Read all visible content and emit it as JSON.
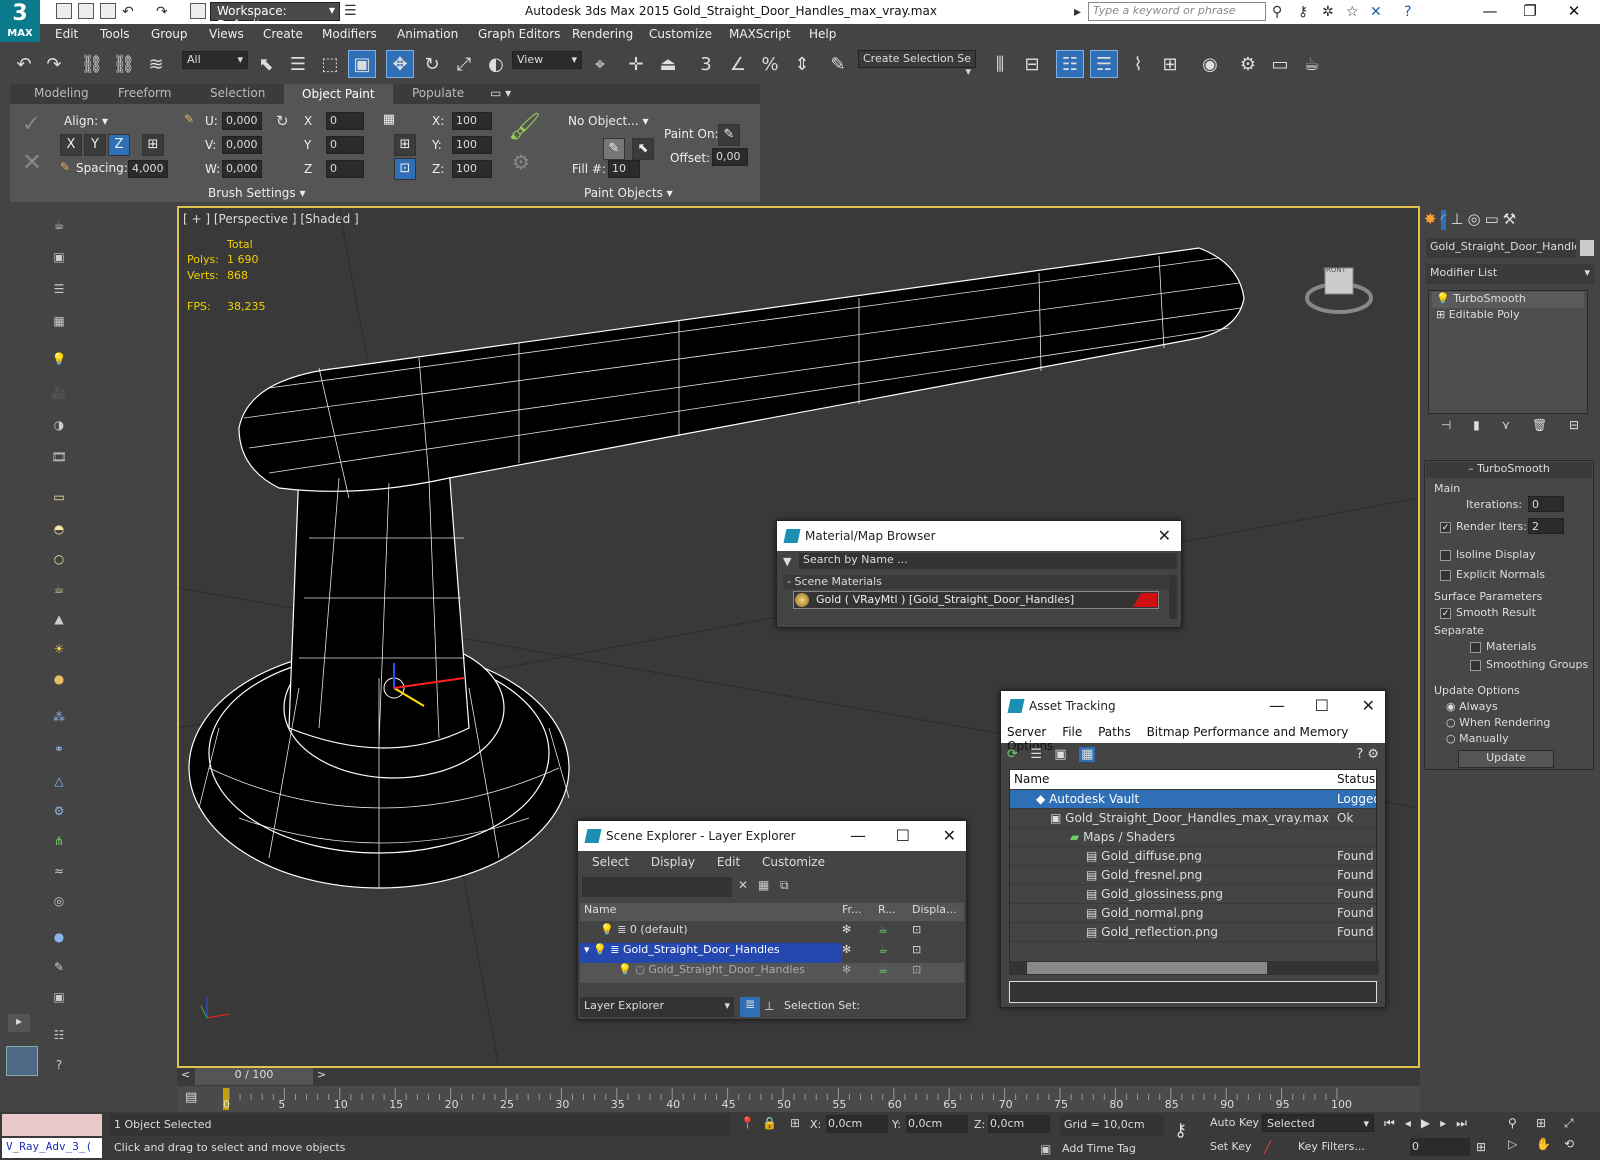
{
  "app": {
    "logo_text": "MAX",
    "workspace": "Workspace: Default",
    "title": "Autodesk 3ds Max  2015    Gold_Straight_Door_Handles_max_vray.max",
    "search_placeholder": "Type a keyword or phrase"
  },
  "menu": [
    "Edit",
    "Tools",
    "Group",
    "Views",
    "Create",
    "Modifiers",
    "Animation",
    "Graph Editors",
    "Rendering",
    "Customize",
    "MAXScript",
    "Help"
  ],
  "toolbar": {
    "filter": "All",
    "ref_coord": "View",
    "selection_set": "Create Selection Se"
  },
  "ribbon": {
    "tabs": [
      "Modeling",
      "Freeform",
      "Selection",
      "Object Paint",
      "Populate"
    ],
    "active_tab": "Object Paint",
    "align_label": "Align:",
    "axes": [
      "X",
      "Y",
      "Z"
    ],
    "spacing_label": "Spacing:",
    "spacing_value": "4,000",
    "u_label": "U:",
    "v_label": "V:",
    "w_label": "W:",
    "u_value": "0,000",
    "v_value": "0,000",
    "w_value": "0,000",
    "rx_label": "X",
    "ry_label": "Y",
    "rz_label": "Z",
    "rx": "0",
    "ry": "0",
    "rz": "0",
    "sx_label": "X:",
    "sy_label": "Y:",
    "sz_label": "Z:",
    "sx": "100",
    "sy": "100",
    "sz": "100",
    "no_object": "No Object...",
    "fill_label": "Fill #:",
    "fill_value": "10",
    "paint_on_label": "Paint On:",
    "offset_label": "Offset:",
    "offset_value": "0,00",
    "brush_settings": "Brush Settings",
    "paint_objects": "Paint Objects"
  },
  "viewport": {
    "label": "[ + ] [Perspective ] [Shaded ]",
    "stats_total": "Total",
    "polys_label": "Polys:",
    "polys": "1 690",
    "verts_label": "Verts:",
    "verts": "868",
    "fps_label": "FPS:",
    "fps": "38,235",
    "viewcube": "FRONT"
  },
  "command_panel": {
    "object_name": "Gold_Straight_Door_Handles",
    "modifier_list": "Modifier List",
    "stack": [
      "TurboSmooth",
      "Editable Poly"
    ],
    "rollout": "TurboSmooth",
    "main": "Main",
    "iterations_label": "Iterations:",
    "iterations": "0",
    "render_iters_label": "Render Iters:",
    "render_iters": "2",
    "isoline": "Isoline Display",
    "explicit_normals": "Explicit Normals",
    "surface_params": "Surface Parameters",
    "smooth_result": "Smooth Result",
    "separate": "Separate",
    "materials": "Materials",
    "smoothing_groups": "Smoothing Groups",
    "update_options": "Update Options",
    "always": "Always",
    "when_rendering": "When Rendering",
    "manually": "Manually",
    "update_button": "Update"
  },
  "material_browser": {
    "title": "Material/Map Browser",
    "search": "Search by Name ...",
    "section": "- Scene Materials",
    "material": "Gold  ( VRayMtl ) [Gold_Straight_Door_Handles]"
  },
  "asset_tracking": {
    "title": "Asset Tracking",
    "menu": [
      "Server",
      "File",
      "Paths",
      "Bitmap Performance and Memory",
      "Options"
    ],
    "col_name": "Name",
    "col_status": "Status",
    "rows": [
      {
        "name": "Autodesk Vault",
        "status": "Logged Out ...",
        "indent": 0
      },
      {
        "name": "Gold_Straight_Door_Handles_max_vray.max",
        "status": "Ok",
        "indent": 1
      },
      {
        "name": "Maps / Shaders",
        "status": "",
        "indent": 2
      },
      {
        "name": "Gold_diffuse.png",
        "status": "Found",
        "indent": 3
      },
      {
        "name": "Gold_fresnel.png",
        "status": "Found",
        "indent": 3
      },
      {
        "name": "Gold_glossiness.png",
        "status": "Found",
        "indent": 3
      },
      {
        "name": "Gold_normal.png",
        "status": "Found",
        "indent": 3
      },
      {
        "name": "Gold_reflection.png",
        "status": "Found",
        "indent": 3
      }
    ]
  },
  "scene_explorer": {
    "title": "Scene Explorer - Layer Explorer",
    "menu": [
      "Select",
      "Display",
      "Edit",
      "Customize"
    ],
    "cols": [
      "Name",
      "Fr...",
      "R...",
      "Displa..."
    ],
    "rows": [
      {
        "name": "0 (default)"
      },
      {
        "name": "Gold_Straight_Door_Handles"
      },
      {
        "name": "Gold_Straight_Door_Handles"
      }
    ],
    "footer_combo": "Layer Explorer",
    "selection_set": "Selection Set:"
  },
  "timeline": {
    "frame": "0 / 100",
    "ticks": [
      "0",
      "5",
      "10",
      "15",
      "20",
      "25",
      "30",
      "35",
      "40",
      "45",
      "50",
      "55",
      "60",
      "65",
      "70",
      "75",
      "80",
      "85",
      "90",
      "95",
      "100"
    ]
  },
  "status": {
    "script": "V_Ray_Adv_3_(",
    "selected": "1 Object Selected",
    "prompt": "Click and drag to select and move objects",
    "x_label": "X:",
    "y_label": "Y:",
    "z_label": "Z:",
    "x": "0,0cm",
    "y": "0,0cm",
    "z": "0,0cm",
    "grid": "Grid = 10,0cm",
    "add_time_tag": "Add Time Tag",
    "auto_key": "Auto Key",
    "set_key": "Set Key",
    "selected_combo": "Selected",
    "key_filters": "Key Filters...",
    "frame": "0"
  }
}
